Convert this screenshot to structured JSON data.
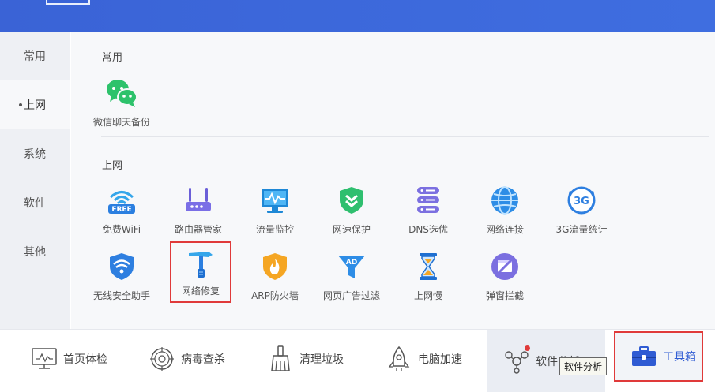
{
  "sidebar": {
    "items": [
      {
        "label": "常用"
      },
      {
        "label": "上网",
        "active": true
      },
      {
        "label": "系统"
      },
      {
        "label": "软件"
      },
      {
        "label": "其他"
      }
    ]
  },
  "sections": {
    "common": {
      "title": "常用",
      "tools": [
        {
          "label": "微信聊天备份",
          "icon": "wechat-icon"
        }
      ]
    },
    "internet": {
      "title": "上网",
      "tools": [
        {
          "label": "免费WiFi",
          "icon": "free-wifi-icon",
          "badge": "FREE"
        },
        {
          "label": "路由器管家",
          "icon": "router-icon"
        },
        {
          "label": "流量监控",
          "icon": "traffic-monitor-icon"
        },
        {
          "label": "网速保护",
          "icon": "speed-shield-icon"
        },
        {
          "label": "DNS选优",
          "icon": "dns-server-icon"
        },
        {
          "label": "网络连接",
          "icon": "globe-icon"
        },
        {
          "label": "3G流量统计",
          "icon": "3g-icon",
          "badge": "3G"
        },
        {
          "label": "无线安全助手",
          "icon": "wifi-shield-icon"
        },
        {
          "label": "网络修复",
          "icon": "network-repair-hammer-icon",
          "highlighted": true
        },
        {
          "label": "ARP防火墙",
          "icon": "arp-firewall-icon"
        },
        {
          "label": "网页广告过滤",
          "icon": "ad-filter-funnel-icon",
          "badge": "AD"
        },
        {
          "label": "上网慢",
          "icon": "hourglass-icon"
        },
        {
          "label": "弹窗拦截",
          "icon": "popup-block-icon"
        }
      ]
    }
  },
  "bottom_nav": [
    {
      "label": "首页体检",
      "icon": "monitor-checkup-icon"
    },
    {
      "label": "病毒查杀",
      "icon": "virus-target-icon"
    },
    {
      "label": "清理垃圾",
      "icon": "broom-icon"
    },
    {
      "label": "电脑加速",
      "icon": "rocket-icon"
    },
    {
      "label": "软件分析",
      "icon": "software-analysis-icon",
      "hovered": true
    },
    {
      "label": "工具箱",
      "icon": "toolbox-icon",
      "active": true,
      "highlighted": true
    }
  ],
  "tooltip": {
    "text": "软件分析"
  },
  "colors": {
    "header_blue": "#3a63d6",
    "accent_blue": "#2f5bd3",
    "highlight_red": "#e03a3a",
    "wechat_green": "#2dc26b"
  }
}
